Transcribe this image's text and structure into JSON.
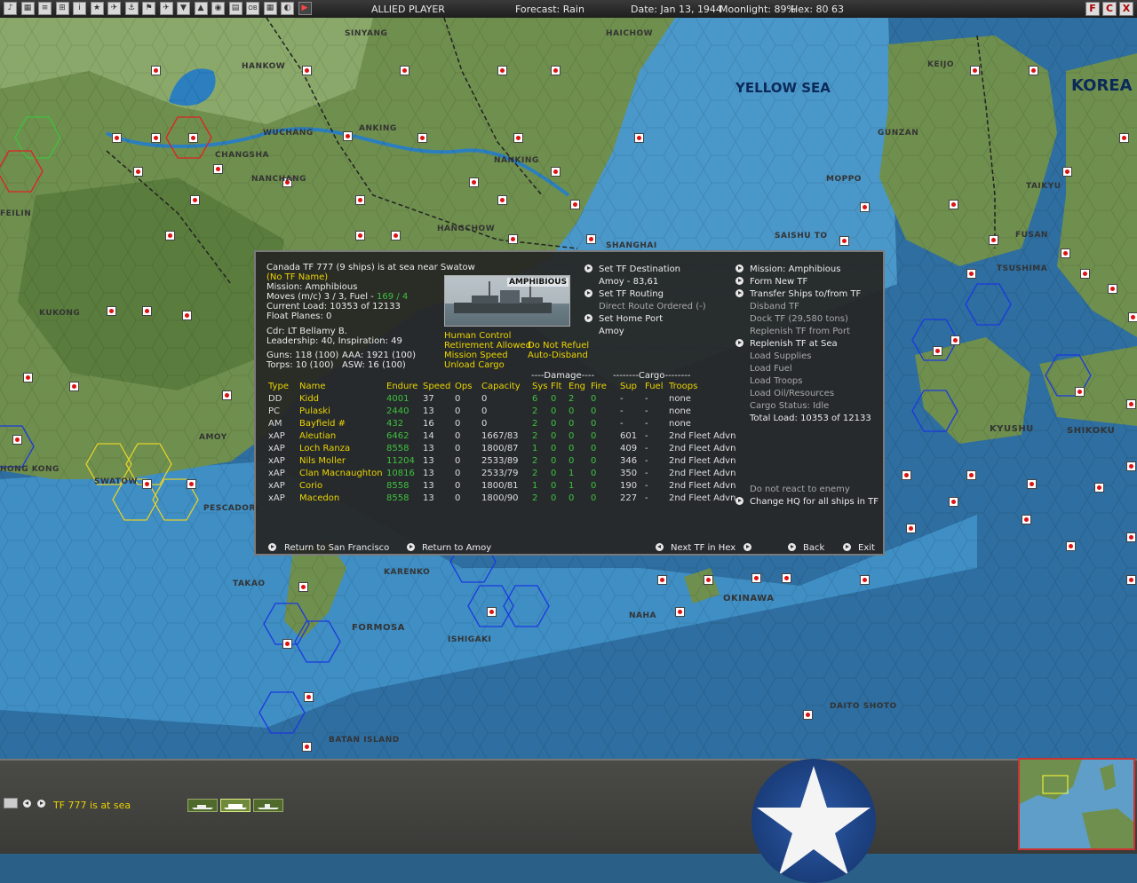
{
  "topbar": {
    "player": "ALLIED PLAYER",
    "forecast": "Forecast: Rain",
    "date": "Date: Jan 13, 1944",
    "moonlight": "Moonlight: 89%",
    "hex": "Hex: 80  63",
    "toolbar_icons": [
      "sound-icon",
      "map-icon",
      "list-icon",
      "bases-icon",
      "info-icon",
      "star-icon",
      "air-icon",
      "ship-icon",
      "flag-icon",
      "plane-icon",
      "sub-icon",
      "land-icon",
      "globe-icon",
      "report-icon",
      "ob-icon",
      "table-icon",
      "ops-icon",
      "end-turn-icon"
    ],
    "ob_label": "OB",
    "window_buttons": [
      "F",
      "C",
      "X"
    ]
  },
  "map": {
    "cities": [
      "SINYANG",
      "HAICHOW",
      "HANKOW",
      "KEIJO",
      "WUCHANG",
      "ANKING",
      "GUNZAN",
      "CHANGSHA",
      "NANKING",
      "TAIKYU",
      "MOPPO",
      "NANCHANG",
      "HANGCHOW",
      "SAISHU TO",
      "FUSAN",
      "SHANGHAI",
      "TSUSHIMA",
      "FEILIN",
      "KUKONG",
      "KYUSHU",
      "SHIKOKU",
      "AMOY",
      "HONG KONG",
      "SWATOW",
      "PESCADORI",
      "TAKAO",
      "KARENKO",
      "OKINAWA",
      "NAHA",
      "FORMOSA",
      "ISHIGAKI",
      "DAITO SHOTO",
      "BATAN ISLAND"
    ],
    "seas": [
      "YELLOW SEA",
      "KOREA"
    ]
  },
  "dialog": {
    "header": {
      "title": "Canada TF 777 (9 ships) is at sea near Swatow",
      "tf_name": "(No TF Name)",
      "mission": "Mission: Amphibious",
      "moves_prefix": "Moves (m/c) 3 / 3, Fuel - ",
      "moves_fuel": "169 / 4",
      "current_load": "Current Load: 10353 of 12133",
      "float_planes": "Float Planes: 0",
      "commander": "Cdr: LT Bellamy B.",
      "leadership": "Leadership: 40, Inspiration: 49",
      "guns": "Guns: 118 (100)",
      "aaa": "AAA: 1921 (100)",
      "torps": "Torps: 10 (100)",
      "asw": "ASW: 16 (100)"
    },
    "ship_image_label": "AMPHIBIOUS",
    "options": {
      "human_control": "Human Control",
      "retirement": "Retirement Allowed",
      "no_refuel": "Do Not Refuel",
      "mission_speed": "Mission Speed",
      "auto_disband": "Auto-Disband",
      "unload_cargo": "Unload Cargo"
    },
    "middle_menu": {
      "set_destination": "Set TF Destination",
      "destination_value": "Amoy - 83,61",
      "set_routing": "Set TF Routing",
      "direct_route": "Direct Route Ordered (-)",
      "set_home_port": "Set Home Port",
      "home_port_value": "Amoy"
    },
    "right_menu": {
      "mission": "Mission: Amphibious",
      "form_new_tf": "Form New TF",
      "transfer_ships": "Transfer Ships to/from TF",
      "disband_tf": "Disband TF",
      "dock_tf": "Dock TF (29,580 tons)",
      "replenish_port": "Replenish TF from Port",
      "replenish_sea": "Replenish TF at Sea",
      "load_supplies": "Load Supplies",
      "load_fuel": "Load Fuel",
      "load_troops": "Load Troops",
      "load_oil": "Load Oil/Resources",
      "cargo_status": "Cargo Status: Idle",
      "total_load": "Total Load: 10353 of 12133",
      "no_react": "Do not react to enemy",
      "change_hq": "Change HQ for all ships in TF"
    },
    "table": {
      "group_damage": "----Damage----",
      "group_cargo": "--------Cargo--------",
      "headers": {
        "type": "Type",
        "name": "Name",
        "endure": "Endure",
        "speed": "Speed",
        "ops": "Ops",
        "capacity": "Capacity",
        "sys": "Sys",
        "flt": "Flt",
        "eng": "Eng",
        "fire": "Fire",
        "sup": "Sup",
        "fuel": "Fuel",
        "troops": "Troops"
      },
      "rows": [
        {
          "type": "DD",
          "name": "Kidd",
          "endure": "4001",
          "speed": "37",
          "ops": "0",
          "capacity": "0",
          "sys": "6",
          "flt": "0",
          "eng": "2",
          "fire": "0",
          "sup": "-",
          "fuel": "-",
          "troops": "none"
        },
        {
          "type": "PC",
          "name": "Pulaski",
          "endure": "2440",
          "speed": "13",
          "ops": "0",
          "capacity": "0",
          "sys": "2",
          "flt": "0",
          "eng": "0",
          "fire": "0",
          "sup": "-",
          "fuel": "-",
          "troops": "none"
        },
        {
          "type": "AM",
          "name": "Bayfield #",
          "endure": "432",
          "speed": "16",
          "ops": "0",
          "capacity": "0",
          "sys": "2",
          "flt": "0",
          "eng": "0",
          "fire": "0",
          "sup": "-",
          "fuel": "-",
          "troops": "none"
        },
        {
          "type": "xAP",
          "name": "Aleutian",
          "endure": "6462",
          "speed": "14",
          "ops": "0",
          "capacity": "1667/83",
          "sys": "2",
          "flt": "0",
          "eng": "0",
          "fire": "0",
          "sup": "601",
          "fuel": "-",
          "troops": "2nd Fleet Advn"
        },
        {
          "type": "xAP",
          "name": "Loch Ranza",
          "endure": "8558",
          "speed": "13",
          "ops": "0",
          "capacity": "1800/87",
          "sys": "1",
          "flt": "0",
          "eng": "0",
          "fire": "0",
          "sup": "409",
          "fuel": "-",
          "troops": "2nd Fleet Advn"
        },
        {
          "type": "xAP",
          "name": "Nils Moller",
          "endure": "11204",
          "speed": "13",
          "ops": "0",
          "capacity": "2533/89",
          "sys": "2",
          "flt": "0",
          "eng": "0",
          "fire": "0",
          "sup": "346",
          "fuel": "-",
          "troops": "2nd Fleet Advn"
        },
        {
          "type": "xAP",
          "name": "Clan Macnaughton",
          "endure": "10816",
          "speed": "13",
          "ops": "0",
          "capacity": "2533/79",
          "sys": "2",
          "flt": "0",
          "eng": "1",
          "fire": "0",
          "sup": "350",
          "fuel": "-",
          "troops": "2nd Fleet Advn"
        },
        {
          "type": "xAP",
          "name": "Corio",
          "endure": "8558",
          "speed": "13",
          "ops": "0",
          "capacity": "1800/81",
          "sys": "1",
          "flt": "0",
          "eng": "1",
          "fire": "0",
          "sup": "190",
          "fuel": "-",
          "troops": "2nd Fleet Advn"
        },
        {
          "type": "xAP",
          "name": "Macedon",
          "endure": "8558",
          "speed": "13",
          "ops": "0",
          "capacity": "1800/90",
          "sys": "2",
          "flt": "0",
          "eng": "0",
          "fire": "0",
          "sup": "227",
          "fuel": "-",
          "troops": "2nd Fleet Advn"
        }
      ]
    },
    "footer": {
      "return_sf": "Return to San Francisco",
      "return_amoy": "Return to Amoy",
      "next_tf": "Next TF in Hex",
      "back": "Back",
      "exit": "Exit"
    }
  },
  "bottom": {
    "status": "TF 777 is at sea"
  }
}
